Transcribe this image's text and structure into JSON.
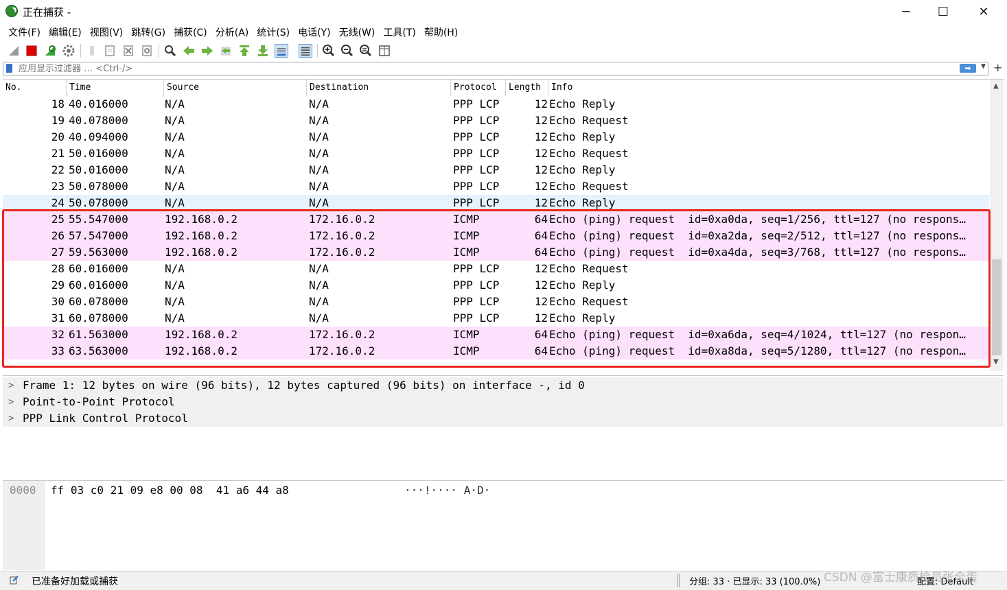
{
  "window": {
    "title": "正在捕获 -"
  },
  "menu": [
    "文件(F)",
    "编辑(E)",
    "视图(V)",
    "跳转(G)",
    "捕获(C)",
    "分析(A)",
    "统计(S)",
    "电话(Y)",
    "无线(W)",
    "工具(T)",
    "帮助(H)"
  ],
  "filter": {
    "placeholder": "应用显示过滤器 … <Ctrl-/>",
    "apply_arrow": "➡"
  },
  "columns": [
    "No.",
    "Time",
    "Source",
    "Destination",
    "Protocol",
    "Length",
    "Info"
  ],
  "rows": [
    {
      "no": "18",
      "time": "40.016000",
      "src": "N/A",
      "dst": "N/A",
      "proto": "PPP LCP",
      "len": "12",
      "info": "Echo Reply",
      "color": "#ffffff"
    },
    {
      "no": "19",
      "time": "40.078000",
      "src": "N/A",
      "dst": "N/A",
      "proto": "PPP LCP",
      "len": "12",
      "info": "Echo Request",
      "color": "#ffffff"
    },
    {
      "no": "20",
      "time": "40.094000",
      "src": "N/A",
      "dst": "N/A",
      "proto": "PPP LCP",
      "len": "12",
      "info": "Echo Reply",
      "color": "#ffffff"
    },
    {
      "no": "21",
      "time": "50.016000",
      "src": "N/A",
      "dst": "N/A",
      "proto": "PPP LCP",
      "len": "12",
      "info": "Echo Request",
      "color": "#ffffff"
    },
    {
      "no": "22",
      "time": "50.016000",
      "src": "N/A",
      "dst": "N/A",
      "proto": "PPP LCP",
      "len": "12",
      "info": "Echo Reply",
      "color": "#ffffff"
    },
    {
      "no": "23",
      "time": "50.078000",
      "src": "N/A",
      "dst": "N/A",
      "proto": "PPP LCP",
      "len": "12",
      "info": "Echo Request",
      "color": "#ffffff"
    },
    {
      "no": "24",
      "time": "50.078000",
      "src": "N/A",
      "dst": "N/A",
      "proto": "PPP LCP",
      "len": "12",
      "info": "Echo Reply",
      "color": "#e6f2fd"
    },
    {
      "no": "25",
      "time": "55.547000",
      "src": "192.168.0.2",
      "dst": "172.16.0.2",
      "proto": "ICMP",
      "len": "64",
      "info": "Echo (ping) request  id=0xa0da, seq=1/256, ttl=127 (no respons…",
      "color": "#fce0fc"
    },
    {
      "no": "26",
      "time": "57.547000",
      "src": "192.168.0.2",
      "dst": "172.16.0.2",
      "proto": "ICMP",
      "len": "64",
      "info": "Echo (ping) request  id=0xa2da, seq=2/512, ttl=127 (no respons…",
      "color": "#fce0fc"
    },
    {
      "no": "27",
      "time": "59.563000",
      "src": "192.168.0.2",
      "dst": "172.16.0.2",
      "proto": "ICMP",
      "len": "64",
      "info": "Echo (ping) request  id=0xa4da, seq=3/768, ttl=127 (no respons…",
      "color": "#fce0fc"
    },
    {
      "no": "28",
      "time": "60.016000",
      "src": "N/A",
      "dst": "N/A",
      "proto": "PPP LCP",
      "len": "12",
      "info": "Echo Request",
      "color": "#ffffff"
    },
    {
      "no": "29",
      "time": "60.016000",
      "src": "N/A",
      "dst": "N/A",
      "proto": "PPP LCP",
      "len": "12",
      "info": "Echo Reply",
      "color": "#ffffff"
    },
    {
      "no": "30",
      "time": "60.078000",
      "src": "N/A",
      "dst": "N/A",
      "proto": "PPP LCP",
      "len": "12",
      "info": "Echo Request",
      "color": "#ffffff"
    },
    {
      "no": "31",
      "time": "60.078000",
      "src": "N/A",
      "dst": "N/A",
      "proto": "PPP LCP",
      "len": "12",
      "info": "Echo Reply",
      "color": "#ffffff"
    },
    {
      "no": "32",
      "time": "61.563000",
      "src": "192.168.0.2",
      "dst": "172.16.0.2",
      "proto": "ICMP",
      "len": "64",
      "info": "Echo (ping) request  id=0xa6da, seq=4/1024, ttl=127 (no respon…",
      "color": "#fce0fc"
    },
    {
      "no": "33",
      "time": "63.563000",
      "src": "192.168.0.2",
      "dst": "172.16.0.2",
      "proto": "ICMP",
      "len": "64",
      "info": "Echo (ping) request  id=0xa8da, seq=5/1280, ttl=127 (no respon…",
      "color": "#fce0fc"
    }
  ],
  "details": [
    "Frame 1: 12 bytes on wire (96 bits), 12 bytes captured (96 bits) on interface -, id 0",
    "Point-to-Point Protocol",
    "PPP Link Control Protocol"
  ],
  "bytes": {
    "offset": "0000",
    "hex": "ff 03 c0 21 09 e8 00 08  41 a6 44 a8",
    "ascii": "···!···· A·D·"
  },
  "status": {
    "ready": "已准备好加载或捕获",
    "packets": "分组: 33 · 已显示: 33 (100.0%)",
    "profile": "配置: Default"
  },
  "watermark": "CSDN @富士康质检员张全蛋",
  "colors": {
    "icmp_row": "#fce0fc",
    "selected_row": "#e6f2fd",
    "highlight_border": "#e8261e"
  }
}
